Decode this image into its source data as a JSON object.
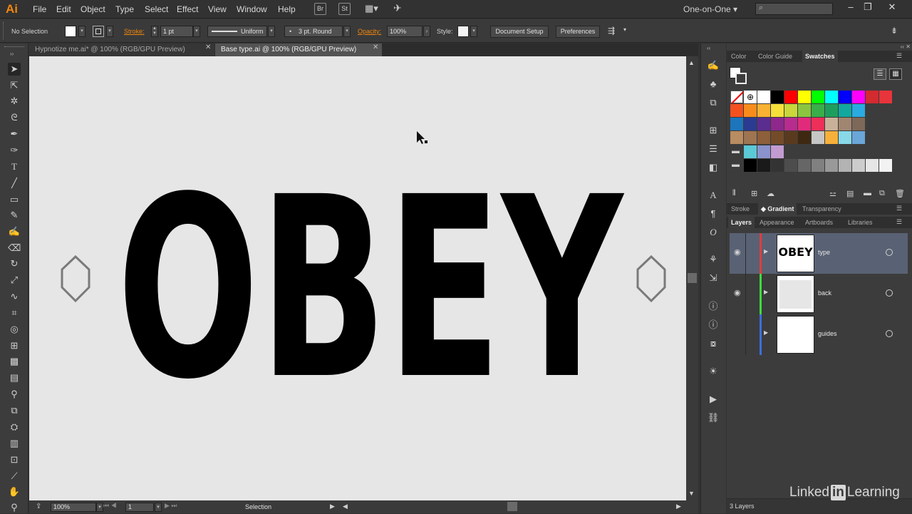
{
  "app": {
    "logo": "Ai"
  },
  "menu": [
    "File",
    "Edit",
    "Object",
    "Type",
    "Select",
    "Effect",
    "View",
    "Window",
    "Help"
  ],
  "menu_icons": {
    "bridge": "Br",
    "stock": "St"
  },
  "workspace": "One-on-One",
  "control": {
    "selection": "No Selection",
    "stroke_label": "Stroke:",
    "stroke_value": "1 pt",
    "profile": "Uniform",
    "brush": "3 pt. Round",
    "opacity_label": "Opacity:",
    "opacity_value": "100%",
    "style_label": "Style:",
    "doc_setup": "Document Setup",
    "preferences": "Preferences"
  },
  "tabs": [
    {
      "label": "Hypnotize me.ai* @ 100% (RGB/GPU Preview)"
    },
    {
      "label": "Base type.ai @ 100% (RGB/GPU Preview)"
    }
  ],
  "artwork": {
    "text": "OBEY"
  },
  "status": {
    "zoom": "100%",
    "page": "1",
    "tool": "Selection"
  },
  "panel_top_tabs": [
    "Color",
    "Color Guide",
    "Swatches"
  ],
  "panel_mid_tabs": [
    "Stroke",
    "Gradient",
    "Transparency"
  ],
  "panel_layer_tabs": [
    "Layers",
    "Appearance",
    "Artboards",
    "Libraries"
  ],
  "swatch_rows": [
    [
      "#ffffff",
      "#000000",
      "#ff0000",
      "#ffff00",
      "#00ff00",
      "#00ffff",
      "#0000ff",
      "#ff00ff",
      "#d22b30",
      "#e8343b"
    ],
    [
      "#f4511e",
      "#f78c1c",
      "#f8b133",
      "#f6e03a",
      "#c9d73b",
      "#8bc53f",
      "#3aae49",
      "#1e9e5e",
      "#11a8a0",
      "#29aae1"
    ],
    [
      "#1d75bc",
      "#2b3b8f",
      "#5b2d8e",
      "#8e288d",
      "#b72c8e",
      "#e12a7c",
      "#ed2f59",
      "#c9b199",
      "#a08670",
      "#7e6859"
    ],
    [
      "#b98c61",
      "#9f7451",
      "#8d5f3b",
      "#744b29",
      "#5a3a1e",
      "#3e2812",
      "#c6c6c6",
      "#f7b03a",
      "#88d8e8",
      "#6aa6d8"
    ]
  ],
  "swatch_group_1": [
    "#5bc8d6",
    "#8a93cc",
    "#c29cd1"
  ],
  "swatch_group_2": [
    "#000000",
    "#1a1a1a",
    "#333333",
    "#4d4d4d",
    "#666666",
    "#808080",
    "#999999",
    "#b3b3b3",
    "#cccccc",
    "#e6e6e6",
    "#f2f2f2"
  ],
  "layers": [
    {
      "name": "type",
      "color": "#e03d3d",
      "thumb": "OBEY"
    },
    {
      "name": "back",
      "color": "#3ddc3d",
      "thumb": ""
    },
    {
      "name": "guides",
      "color": "#3d6de0",
      "thumb": ""
    }
  ],
  "layers_count": "3 Layers",
  "watermark": {
    "left": "Linked",
    "box": "in",
    "right": "Learning"
  }
}
